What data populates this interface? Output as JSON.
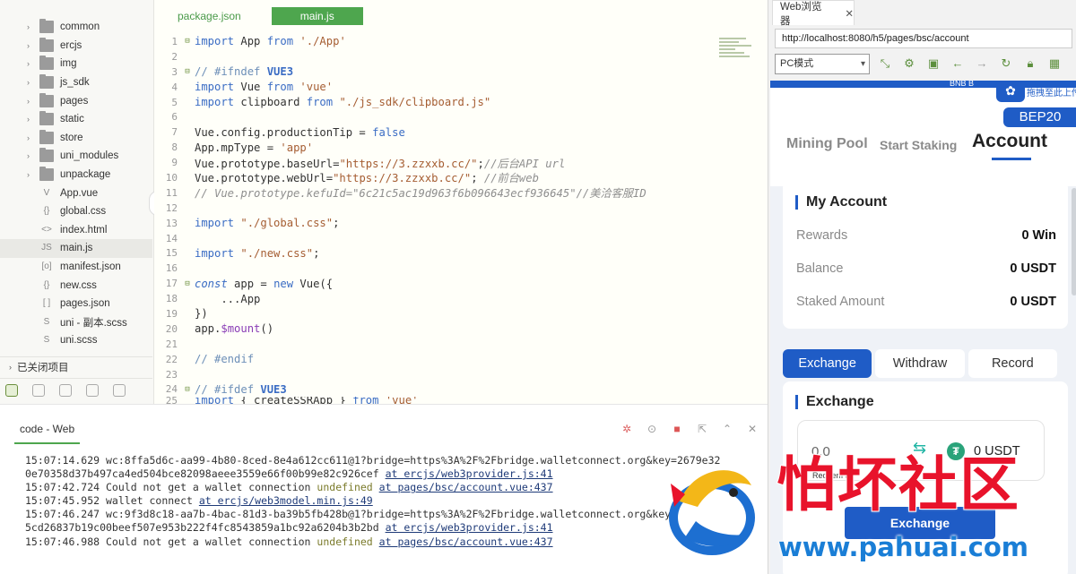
{
  "sidebar": {
    "items": [
      {
        "label": "common",
        "type": "folder"
      },
      {
        "label": "ercjs",
        "type": "folder"
      },
      {
        "label": "img",
        "type": "folder"
      },
      {
        "label": "js_sdk",
        "type": "folder"
      },
      {
        "label": "pages",
        "type": "folder"
      },
      {
        "label": "static",
        "type": "folder"
      },
      {
        "label": "store",
        "type": "folder"
      },
      {
        "label": "uni_modules",
        "type": "folder"
      },
      {
        "label": "unpackage",
        "type": "folder"
      },
      {
        "label": "App.vue",
        "type": "file",
        "glyph": "V"
      },
      {
        "label": "global.css",
        "type": "file",
        "glyph": "{}"
      },
      {
        "label": "index.html",
        "type": "file",
        "glyph": "<>"
      },
      {
        "label": "main.js",
        "type": "file",
        "glyph": "JS",
        "active": true
      },
      {
        "label": "manifest.json",
        "type": "file",
        "glyph": "[o]"
      },
      {
        "label": "new.css",
        "type": "file",
        "glyph": "{}"
      },
      {
        "label": "pages.json",
        "type": "file",
        "glyph": "[ ]"
      },
      {
        "label": "uni - 副本.scss",
        "type": "file",
        "glyph": "S"
      },
      {
        "label": "uni.scss",
        "type": "file",
        "glyph": "S"
      }
    ],
    "closed_projects": "已关闭项目"
  },
  "editor": {
    "tabs": [
      "package.json",
      "main.js"
    ],
    "line_numbers": [
      "1",
      "2",
      "3",
      "4",
      "5",
      "6",
      "7",
      "8",
      "9",
      "10",
      "11",
      "12",
      "13",
      "14",
      "15",
      "16",
      "17",
      "18",
      "19",
      "20",
      "21",
      "22",
      "23",
      "24",
      "25"
    ]
  },
  "console": {
    "tab": "code - Web",
    "lines": {
      "l1a": "15:07:14.629 wc:8ffa5d6c-aa99-4b80-8ced-8e4a612cc611@1?bridge=https%3A%2F%2Fbridge.walletconnect.org&key=2679e32",
      "l1b": "0e70358d37b497ca4ed504bce82098aeee3559e66f00b99e82c926cef ",
      "l1link": "at ercjs/web3provider.js:41",
      "l2a": "15:07:42.724 Could not get a wallet connection ",
      "l2undef": "undefined",
      "l2link": "at pages/bsc/account.vue:437",
      "l3a": "15:07:45.952 wallet connect ",
      "l3link": "at ercjs/web3model.min.js:49",
      "l4a": "15:07:46.247 wc:9f3d8c18-aa7b-4bac-81d3-ba39b5fb428b@1?bridge=https%3A%2F%2Fbridge.walletconnect.org&key=f",
      "l4b": "5cd26837b19c00beef507e953b222f4fc8543859a1bc92a6204b3b2bd ",
      "l4link": "at ercjs/web3provider.js:41",
      "l5a": "15:07:46.988 Could not get a wallet connection ",
      "l5undef": "undefined",
      "l5link": "at pages/bsc/account.vue:437"
    }
  },
  "browser": {
    "tab": "Web浏览器",
    "url": "http://localhost:8080/h5/pages/bsc/account",
    "mode": "PC模式"
  },
  "app": {
    "bnb": "BNB B",
    "float_text": "拖拽至此上传",
    "network": "BEP20",
    "nav": [
      "Mining Pool",
      "Start Staking",
      "Account"
    ],
    "my_account": "My Account",
    "rows": [
      {
        "k": "Rewards",
        "v": "0 Win"
      },
      {
        "k": "Balance",
        "v": "0 USDT"
      },
      {
        "k": "Staked Amount",
        "v": "0 USDT"
      }
    ],
    "segments": [
      "Exchange",
      "Withdraw",
      "Record"
    ],
    "exchange_title": "Exchange",
    "amount": "0.0",
    "usdt": "0 USDT",
    "redeem": "Redeem all",
    "exchange_btn": "Exchange"
  },
  "watermark": {
    "title": "怕坏社区",
    "url": "www.pahuai.com"
  },
  "colors": {
    "accent": "#1f5cc6",
    "editor_green": "#4ea64e",
    "watermark_red": "#e8132b",
    "watermark_blue": "#1a7ed6"
  }
}
